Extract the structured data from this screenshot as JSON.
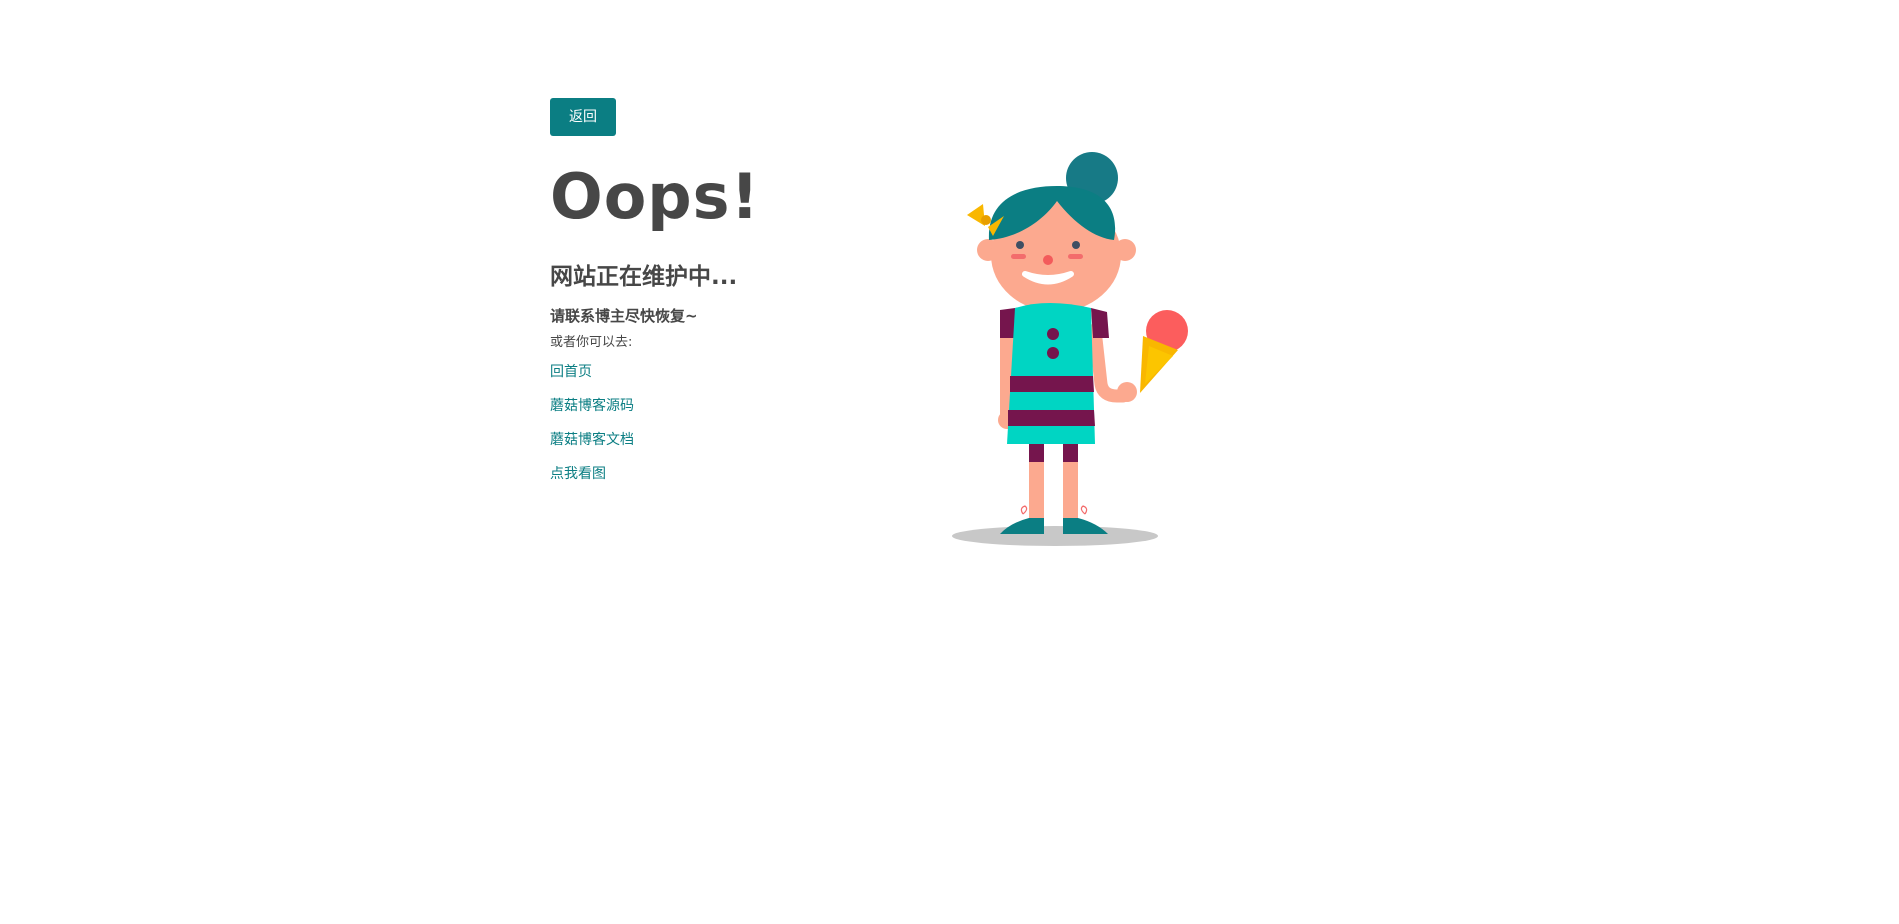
{
  "toolbar": {
    "back_label": "返回"
  },
  "main": {
    "heading": "Oops!",
    "subheading": "网站正在维护中...",
    "contact_text": "请联系博主尽快恢复~",
    "or_text": "或者你可以去:",
    "links": [
      {
        "label": "回首页"
      },
      {
        "label": "蘑菇博客源码"
      },
      {
        "label": "蘑菇博客文档"
      },
      {
        "label": "点我看图"
      }
    ]
  },
  "colors": {
    "accent": "#0b7e83",
    "text": "#474747",
    "background": "#ffffff"
  },
  "illustration": {
    "icon": "girl-with-ice-cream-illustration"
  }
}
